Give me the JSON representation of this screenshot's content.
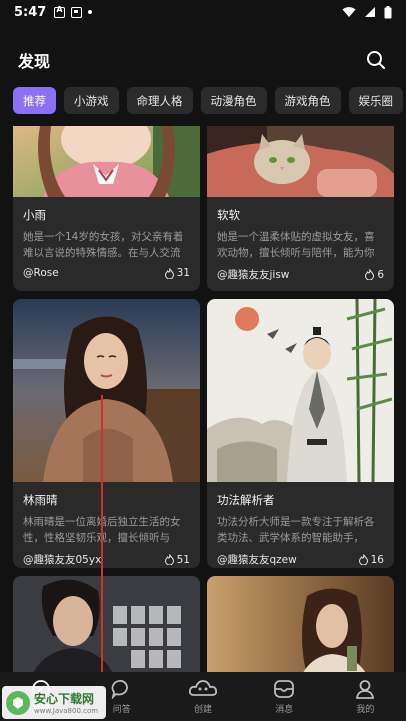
{
  "status_bar": {
    "time": "5:47"
  },
  "header": {
    "title": "发现"
  },
  "tabs": [
    "推荐",
    "小游戏",
    "命理人格",
    "动漫角色",
    "游戏角色",
    "娱乐圈"
  ],
  "cards": [
    {
      "name": "小雨",
      "desc": "她是一个14岁的女孩，对父亲有着难以言说的特殊情感。在与人交流时",
      "author": "@Rose",
      "likes": "31"
    },
    {
      "name": "软软",
      "desc": "她是一个温柔体贴的虚拟女友，喜欢动物，擅长倾听与陪伴，能为你",
      "author": "@趣猿友友jisw",
      "likes": "6"
    },
    {
      "name": "林雨晴",
      "desc": "林雨晴是一位离婚后独立生活的女性，性格坚韧乐观，擅长倾听与",
      "author": "@趣猿友友05yx",
      "likes": "51"
    },
    {
      "name": "功法解析者",
      "desc": "功法分析大师是一款专注于解析各类功法、武学体系的智能助手，",
      "author": "@趣猿友友qzew",
      "likes": "16"
    }
  ],
  "nav": [
    "发现",
    "问答",
    "创建",
    "消息",
    "我的"
  ],
  "watermark": {
    "title": "安心下载网",
    "url": "www.Java800.com"
  },
  "colors": {
    "accent": "#8b6ff5",
    "background": "#121212",
    "card": "#2a2a2a"
  }
}
